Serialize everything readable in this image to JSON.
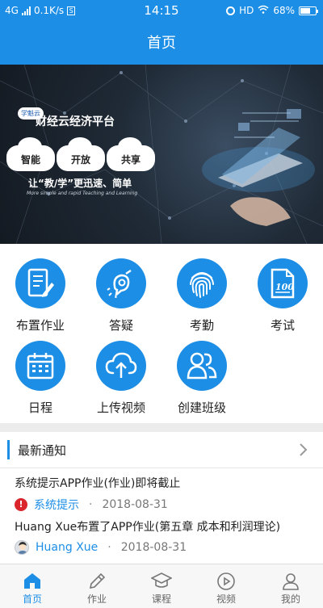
{
  "status_bar": {
    "network": "4G",
    "speed": "0.1K/s",
    "time": "14:15",
    "hd": "HD",
    "battery": "68%"
  },
  "header": {
    "title": "首页"
  },
  "banner": {
    "badge": "学魁云",
    "title": "财经云经济平台",
    "clouds": [
      "智能",
      "开放",
      "共享"
    ],
    "slogan": "让“教/学”更迅速、简单",
    "subtitle": "More simple and rapid Teaching and Learning"
  },
  "features": [
    {
      "label": "布置作业",
      "icon": "assignment-icon"
    },
    {
      "label": "答疑",
      "icon": "qa-icon"
    },
    {
      "label": "考勤",
      "icon": "fingerprint-icon"
    },
    {
      "label": "考试",
      "icon": "exam-icon"
    },
    {
      "label": "日程",
      "icon": "calendar-icon"
    },
    {
      "label": "上传视频",
      "icon": "cloud-upload-icon"
    },
    {
      "label": "创建班级",
      "icon": "create-class-icon"
    }
  ],
  "notices": {
    "title": "最新通知",
    "items": [
      {
        "title": "系统提示APP作业(作业)即将截止",
        "source": "系统提示",
        "dot": "·",
        "date": "2018-08-31"
      },
      {
        "title": "Huang Xue布置了APP作业(第五章 成本和利润理论)",
        "source": "Huang Xue",
        "dot": "·",
        "date": "2018-08-31"
      }
    ]
  },
  "tabs": [
    {
      "label": "首页",
      "active": true
    },
    {
      "label": "作业",
      "active": false
    },
    {
      "label": "课程",
      "active": false
    },
    {
      "label": "视频",
      "active": false
    },
    {
      "label": "我的",
      "active": false
    }
  ],
  "colors": {
    "primary": "#1c8ee6",
    "warning": "#d9252b"
  }
}
